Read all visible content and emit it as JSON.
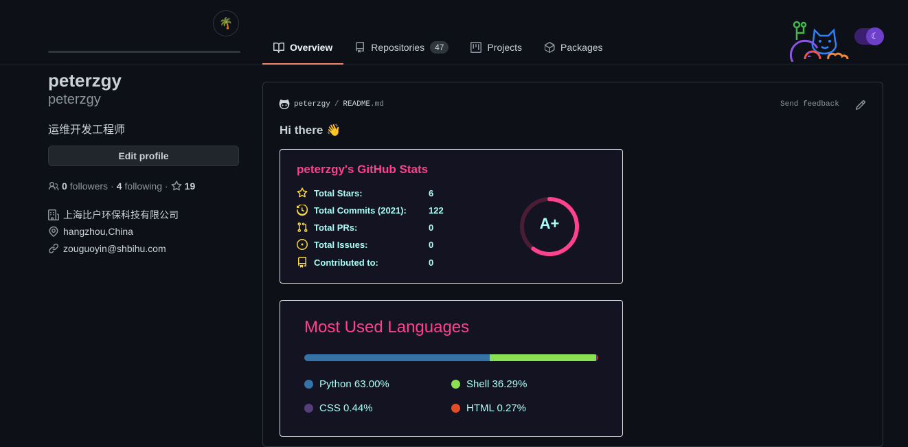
{
  "header": {
    "status_emoji": "🌴",
    "tabs": [
      {
        "label": "Overview",
        "icon": "book-icon",
        "active": true
      },
      {
        "label": "Repositories",
        "icon": "repo-icon",
        "count": "47"
      },
      {
        "label": "Projects",
        "icon": "project-icon"
      },
      {
        "label": "Packages",
        "icon": "package-icon"
      }
    ]
  },
  "profile": {
    "name": "peterzgy",
    "login": "peterzgy",
    "bio": "运维开发工程师",
    "edit_label": "Edit profile",
    "followers_count": "0",
    "followers_label": "followers",
    "following_count": "4",
    "following_label": "following",
    "stars_count": "19",
    "sep": "·",
    "company": "上海比户环保科技有限公司",
    "location": "hangzhou,China",
    "email": "zouguoyin@shbihu.com"
  },
  "readme": {
    "owner": "peterzgy",
    "slash": "/",
    "file": "README",
    "ext": ".md",
    "feedback": "Send feedback",
    "greeting": "Hi there 👋"
  },
  "stats_card": {
    "title": "peterzgy's GitHub Stats",
    "rows": [
      {
        "label": "Total Stars:",
        "value": "6"
      },
      {
        "label": "Total Commits (2021):",
        "value": "122"
      },
      {
        "label": "Total PRs:",
        "value": "0"
      },
      {
        "label": "Total Issues:",
        "value": "0"
      },
      {
        "label": "Contributed to:",
        "value": "0"
      }
    ],
    "rank": "A+",
    "rank_progress": 0.6,
    "title_color": "#fe428e",
    "text_color": "#a9fef7",
    "icon_color": "#f8d847"
  },
  "languages_card": {
    "title": "Most Used Languages",
    "languages": [
      {
        "name": "Python",
        "percent": "63.00%",
        "value": 63.0,
        "color": "#3572A5"
      },
      {
        "name": "Shell",
        "percent": "36.29%",
        "value": 36.29,
        "color": "#89e051"
      },
      {
        "name": "CSS",
        "percent": "0.44%",
        "value": 0.44,
        "color": "#563d7c"
      },
      {
        "name": "HTML",
        "percent": "0.27%",
        "value": 0.27,
        "color": "#e34c26"
      }
    ]
  }
}
